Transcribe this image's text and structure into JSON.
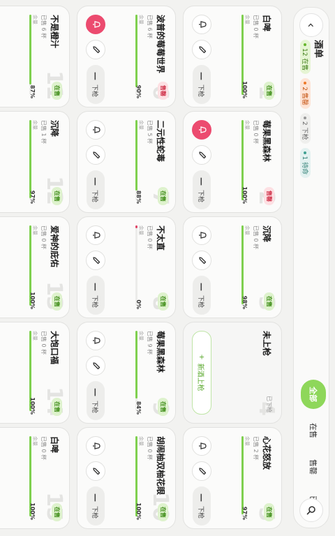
{
  "header": {
    "title": "酒单",
    "counts": [
      {
        "label": "12 在售",
        "kind": "on"
      },
      {
        "label": "2 售罄",
        "kind": "sold"
      },
      {
        "label": "2 下枪",
        "kind": "off"
      },
      {
        "label": "1 待命",
        "kind": "pend"
      }
    ]
  },
  "filters": {
    "tabs": [
      "全部",
      "在售",
      "售罄",
      "已下枪"
    ],
    "active": 0
  },
  "card_text": {
    "remaining_label": "余量",
    "off_button": "下枪",
    "add_button": "新酒上枪"
  },
  "cards": [
    {
      "num": "1",
      "name": "白啤",
      "sold": "已售 0 杯",
      "status": "在售",
      "status_kind": "on",
      "percent": "100%",
      "pct": 100,
      "alert": false
    },
    {
      "num": "2",
      "name": "莓果黑森林",
      "sold": "已售 0 杯",
      "status": "售罄",
      "status_kind": "soldout",
      "percent": "100%",
      "pct": 100,
      "alert": true
    },
    {
      "num": "3",
      "name": "沉降",
      "sold": "已售 0 杯",
      "status": "在售",
      "status_kind": "on",
      "percent": "98%",
      "pct": 98,
      "alert": false
    },
    {
      "num": "4",
      "name": "未上枪",
      "sold": "",
      "status": "已下枪",
      "status_kind": "offb",
      "percent": "",
      "pct": 0,
      "empty": true
    },
    {
      "num": "5",
      "name": "心花怒放",
      "sold": "已售 2 杯",
      "status": "在售",
      "status_kind": "on",
      "percent": "97%",
      "pct": 97,
      "alert": false
    },
    {
      "num": "6",
      "name": "波普的莓莓世界",
      "sold": "已售 6 杯",
      "status": "售罄",
      "status_kind": "soldout",
      "percent": "90%",
      "pct": 90,
      "alert": true
    },
    {
      "num": "7",
      "name": "二元性蛇毒",
      "sold": "已售 5 杯",
      "status": "在售",
      "status_kind": "on",
      "percent": "88%",
      "pct": 88,
      "alert": false
    },
    {
      "num": "8",
      "name": "不太直",
      "sold": "已售 0 杯",
      "status": "在售",
      "status_kind": "on",
      "percent": "0%",
      "pct": 0,
      "alert": false
    },
    {
      "num": "9",
      "name": "莓果黑森林",
      "sold": "已售 9 杯",
      "status": "在售",
      "status_kind": "on",
      "percent": "84%",
      "pct": 84,
      "alert": false
    },
    {
      "num": "10",
      "name": "胡闹柚双柚花眼",
      "sold": "已售 0 杯",
      "status": "在售",
      "status_kind": "on",
      "percent": "100%",
      "pct": 100,
      "alert": false
    },
    {
      "num": "11",
      "name": "不是橙汁",
      "sold": "已售 6 杯",
      "status": "在售",
      "status_kind": "on",
      "percent": "87%",
      "pct": 87,
      "alert": false
    },
    {
      "num": "12",
      "name": "沉降",
      "sold": "已售 1 杯",
      "status": "在售",
      "status_kind": "on",
      "percent": "97%",
      "pct": 97,
      "alert": false
    },
    {
      "num": "13",
      "name": "爱神的庇佑",
      "sold": "已售 0 杯",
      "status": "在售",
      "status_kind": "on",
      "percent": "100%",
      "pct": 100,
      "alert": false
    },
    {
      "num": "14",
      "name": "大饱口福",
      "sold": "已售 0 杯",
      "status": "在售",
      "status_kind": "on",
      "percent": "100%",
      "pct": 100,
      "alert": false
    },
    {
      "num": "15",
      "name": "白啤",
      "sold": "已售 0 杯",
      "status": "在售",
      "status_kind": "on",
      "percent": "100%",
      "pct": 100,
      "alert": false
    }
  ]
}
